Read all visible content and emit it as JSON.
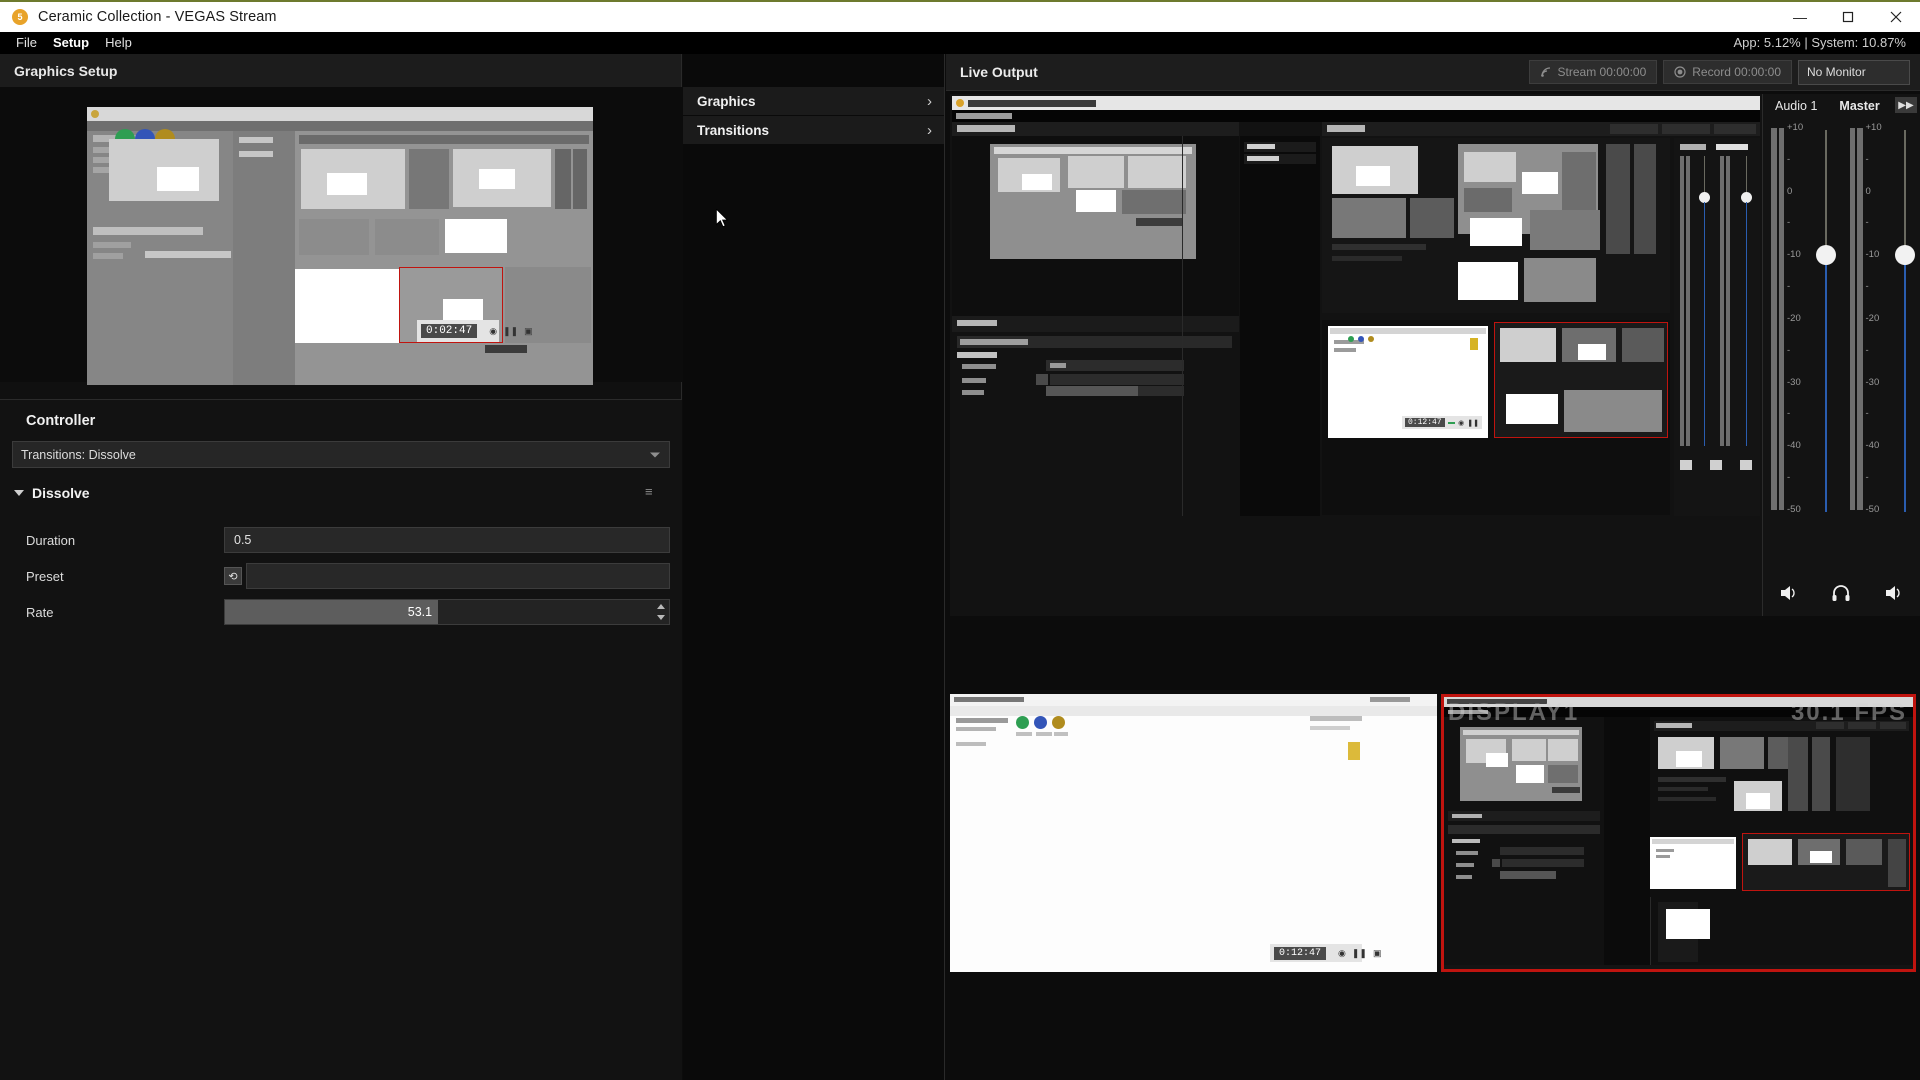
{
  "window": {
    "title": "Ceramic Collection - VEGAS Stream",
    "app_badge": "5",
    "minimize": "—",
    "maximize": "▢",
    "close": "✕"
  },
  "menubar": {
    "items": [
      {
        "label": "File",
        "active": false
      },
      {
        "label": "Setup",
        "active": true
      },
      {
        "label": "Help",
        "active": false
      }
    ],
    "stats": "App: 5.12% | System: 10.87%"
  },
  "graphics_setup": {
    "header": "Graphics Setup",
    "preview_timecode": "0:02:47"
  },
  "controller": {
    "header": "Controller",
    "selected_source": "Transitions: Dissolve",
    "group": {
      "name": "Dissolve",
      "collapse_icon": "▾",
      "menu_icon": "≡"
    },
    "params": [
      {
        "label": "Duration",
        "value": "0.5",
        "type": "text"
      },
      {
        "label": "Preset",
        "value": "",
        "type": "dropdown",
        "reset_icon": "⟲"
      },
      {
        "label": "Rate",
        "value": "53.1",
        "type": "slider",
        "fill_pct": 48
      }
    ]
  },
  "tree": {
    "items": [
      {
        "label": "Graphics",
        "chevron": "›"
      },
      {
        "label": "Transitions",
        "chevron": "›"
      }
    ]
  },
  "live_output": {
    "header": "Live Output",
    "stream_button": "Stream 00:00:00",
    "record_button": "Record 00:00:00",
    "stream_icon": "stream-icon",
    "record_icon": "record-icon",
    "monitor_select": "No Monitor",
    "preview_timecode": "0:12:47",
    "overlay_display": "DISPLAY1",
    "overlay_fps": "30.1 FPS"
  },
  "audio": {
    "channel_label": "Audio 1",
    "master_label": "Master",
    "expand_label": "▶▶",
    "scale": [
      "+10",
      "-",
      "0",
      "-",
      "-10",
      "-",
      "-20",
      "-",
      "-30",
      "-",
      "-40",
      "-",
      "-50"
    ],
    "footer_icons": [
      "speaker-icon",
      "headphone-icon",
      "speaker-icon"
    ]
  },
  "colors": {
    "accent_red": "#c0140f",
    "fader_blue": "#2a5db0",
    "title_badge": "#e8a32a",
    "panel_bg": "#121212"
  }
}
